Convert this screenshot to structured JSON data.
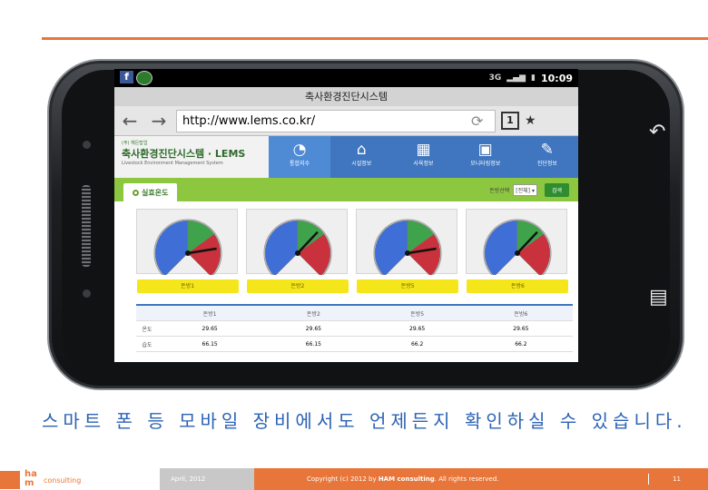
{
  "phone": {
    "statusbar": {
      "time": "10:09",
      "signal": "3G"
    },
    "browser": {
      "page_title": "축사환경진단시스템",
      "url": "http://www.lems.co.kr/",
      "tab_count": "1"
    },
    "site": {
      "brand_sub": "(주) 해든탑업",
      "brand_name": "축사환경진단시스템 · LEMS",
      "brand_en": "Livestock Environment Management System",
      "menu": [
        {
          "label": "통합지수",
          "icon": "gauge-icon"
        },
        {
          "label": "시설정보",
          "icon": "home-icon"
        },
        {
          "label": "사육정보",
          "icon": "calendar-icon"
        },
        {
          "label": "모니터링정보",
          "icon": "monitor-icon"
        },
        {
          "label": "진단정보",
          "icon": "edit-icon"
        }
      ],
      "section_tab": "실효온도",
      "barn_select_label": "돈방선택",
      "barn_select_value": "[전체]",
      "search_label": "검색",
      "gauges": [
        {
          "label": "돈방1",
          "needle": 0.8
        },
        {
          "label": "돈방2",
          "needle": 0.66
        },
        {
          "label": "돈방5",
          "needle": 0.8
        },
        {
          "label": "돈방6",
          "needle": 0.66
        }
      ],
      "table": {
        "headers": [
          "돈방1",
          "돈방2",
          "돈방5",
          "돈방6"
        ],
        "rows": [
          {
            "label": "온도",
            "values": [
              "29.65",
              "29.65",
              "29.65",
              "29.65"
            ]
          },
          {
            "label": "습도",
            "values": [
              "66.15",
              "66.15",
              "66.2",
              "66.2"
            ]
          }
        ]
      }
    }
  },
  "caption": "스마트 폰 등 모바일 장비에서도 언제든지 확인하실 수 있습니다.",
  "footer": {
    "logo_line1": "ha",
    "logo_line2": "m",
    "logo_sub": "consulting",
    "date": "April, 2012",
    "copyright_pre": "Copyright (c) 2012 by ",
    "copyright_brand": "HAM consulting",
    "copyright_post": ". All rights reserved.",
    "page": "11"
  },
  "colors": {
    "accent": "#e8763a",
    "caption_blue": "#2c63b4",
    "site_blue": "#3f76bf",
    "site_green": "#8dc63f"
  }
}
